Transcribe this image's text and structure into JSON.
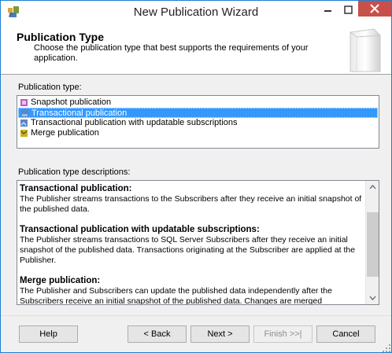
{
  "window": {
    "title": "New Publication Wizard",
    "close_color": "#c7504b",
    "accent": "#3399ff"
  },
  "header": {
    "title": "Publication Type",
    "description": "Choose the publication type that best supports the requirements of your application."
  },
  "publication_types": {
    "label": "Publication type:",
    "items": [
      {
        "label": "Snapshot publication",
        "icon": "snapshot-publication-icon",
        "selected": false
      },
      {
        "label": "Transactional publication",
        "icon": "transactional-publication-icon",
        "selected": true
      },
      {
        "label": "Transactional publication with updatable subscriptions",
        "icon": "updatable-publication-icon",
        "selected": false
      },
      {
        "label": "Merge publication",
        "icon": "merge-publication-icon",
        "selected": false
      }
    ]
  },
  "descriptions": {
    "label": "Publication type descriptions:",
    "items": [
      {
        "heading": "Transactional publication:",
        "text": "The Publisher streams transactions to the Subscribers after they receive an initial snapshot of the published data."
      },
      {
        "heading": "Transactional publication with updatable subscriptions:",
        "text": "The Publisher streams transactions to SQL Server Subscribers after they receive an initial snapshot of the published data. Transactions originating at the Subscriber are applied at the Publisher."
      },
      {
        "heading": "Merge publication:",
        "text": "The Publisher and Subscribers can update the published data independently after the Subscribers receive an initial snapshot of the published data. Changes are merged"
      }
    ]
  },
  "buttons": {
    "help": "Help",
    "back": "< Back",
    "next": "Next >",
    "finish": "Finish >>|",
    "cancel": "Cancel"
  }
}
